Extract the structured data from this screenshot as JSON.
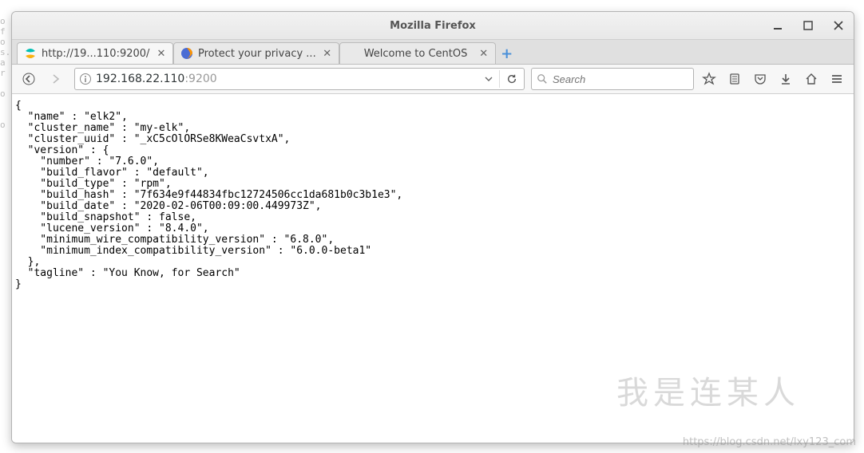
{
  "left_gutter": "o\nf\no\ns.\na\nr\n\no\n\n\no",
  "window": {
    "title": "Mozilla Firefox"
  },
  "tabs": [
    {
      "label": "http://19...110:9200/",
      "favicon": "elastic",
      "active": true
    },
    {
      "label": "Protect your privacy ...",
      "favicon": "firefox",
      "active": false
    },
    {
      "label": "Welcome to CentOS",
      "favicon": "",
      "active": false
    }
  ],
  "urlbar": {
    "host": "192.168.22.110",
    "port": ":9200"
  },
  "searchbar": {
    "placeholder": "Search"
  },
  "response": {
    "name": "elk2",
    "cluster_name": "my-elk",
    "cluster_uuid": "_xC5cOlORSe8KWeaCsvtxA",
    "version": {
      "number": "7.6.0",
      "build_flavor": "default",
      "build_type": "rpm",
      "build_hash": "7f634e9f44834fbc12724506cc1da681b0c3b1e3",
      "build_date": "2020-02-06T00:09:00.449973Z",
      "build_snapshot": false,
      "lucene_version": "8.4.0",
      "minimum_wire_compatibility_version": "6.8.0",
      "minimum_index_compatibility_version": "6.0.0-beta1"
    },
    "tagline": "You Know, for Search"
  },
  "watermark1": "我是连某人",
  "watermark2": "https://blog.csdn.net/lxy123_com"
}
